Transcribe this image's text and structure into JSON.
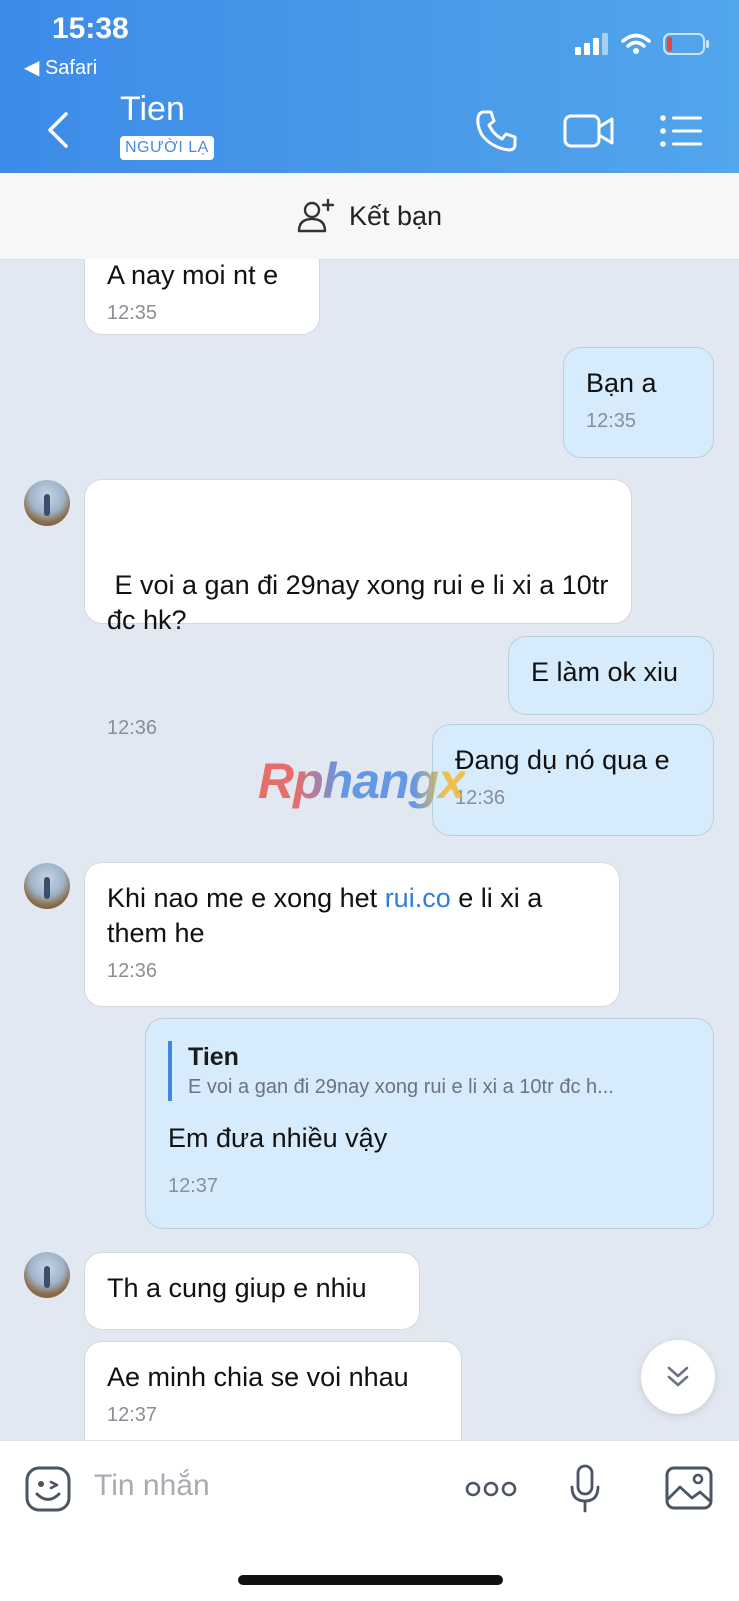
{
  "status_bar": {
    "time": "15:38",
    "back_app": "◀ Safari"
  },
  "header": {
    "contact_name": "Tien",
    "badge": "NGƯỜI LẠ"
  },
  "add_friend": {
    "label": "Kết bạn"
  },
  "messages": [
    {
      "text": "A nay moi nt e",
      "time": "12:35"
    },
    {
      "text": "Bạn a",
      "time": "12:35"
    },
    {
      "text": " E voi a gan đi 29nay xong rui e li xi a 10tr đc hk?",
      "time": "12:36"
    },
    {
      "text": "E làm ok xiu"
    },
    {
      "text": "Đang dụ nó qua e",
      "time": "12:36"
    },
    {
      "text_before": "Khi nao me e xong het ",
      "link": "rui.co",
      "text_after": " e li xi a them he",
      "time": "12:36"
    },
    {
      "quote_name": "Tien",
      "quote_text": "E voi a gan đi 29nay xong rui e li xi a 10tr đc h...",
      "text": "Em đưa nhiều vậy",
      "time": "12:37"
    },
    {
      "text": "Th a cung giup e nhiu"
    },
    {
      "text": "Ae minh chia se voi nhau",
      "time": "12:37"
    }
  ],
  "watermark": "Rphangx",
  "composer": {
    "placeholder": "Tin nhắn"
  },
  "colors": {
    "header_blue": "#3d8be9",
    "outgoing_bubble": "#d6ebfb",
    "incoming_bubble": "#ffffff",
    "chat_background": "#e2e8f1",
    "link": "#2f7fd9"
  }
}
